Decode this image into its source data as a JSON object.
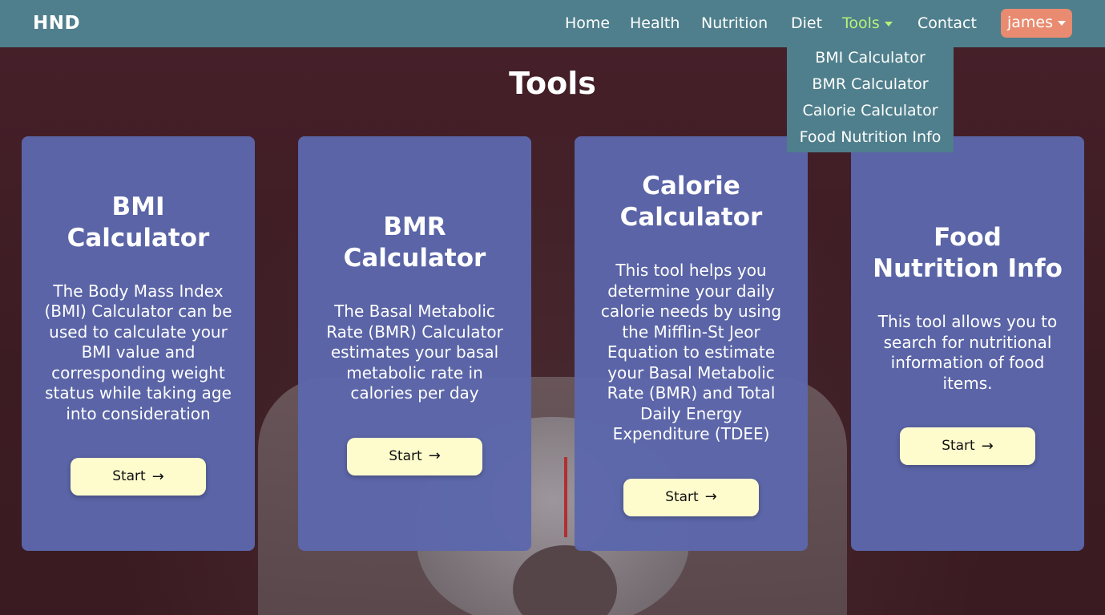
{
  "nav": {
    "brand": "HND",
    "links": [
      {
        "label": "Home"
      },
      {
        "label": "Health"
      },
      {
        "label": "Nutrition"
      },
      {
        "label": "Diet"
      },
      {
        "label": "Tools",
        "active": true
      },
      {
        "label": "Contact"
      }
    ],
    "user": "james",
    "active_color": "#b7f07c",
    "bar_color": "#4f7f8c",
    "user_button_color": "#e88b70"
  },
  "tools_dropdown": {
    "items": [
      "BMI Calculator",
      "BMR Calculator",
      "Calorie Calculator",
      "Food Nutrition Info"
    ]
  },
  "page": {
    "title": "Tools"
  },
  "cards": [
    {
      "title": "BMI Calculator",
      "description": "The Body Mass Index (BMI) Calculator can be used to calculate your BMI value and corresponding weight status while taking age into consideration",
      "button": "Start",
      "button_icon": "arrow-right-icon"
    },
    {
      "title": "BMR Calculator",
      "description": "The Basal Metabolic Rate (BMR) Calculator estimates your basal metabolic rate in calories per day",
      "button": "Start",
      "button_icon": "arrow-right-icon"
    },
    {
      "title": "Calorie Calculator",
      "description": "This tool helps you determine your daily calorie needs by using the Mifflin-St Jeor Equation to estimate your Basal Metabolic Rate (BMR) and Total Daily Energy Expenditure (TDEE)",
      "button": "Start",
      "button_icon": "arrow-right-icon"
    },
    {
      "title": "Food Nutrition Info",
      "description": "This tool allows you to search for nutritional information of food items.",
      "button": "Start",
      "button_icon": "arrow-right-icon"
    }
  ],
  "colors": {
    "card_bg": "#5c67ac",
    "start_button_bg": "#fefccd",
    "page_bg": "#3e1e25"
  }
}
